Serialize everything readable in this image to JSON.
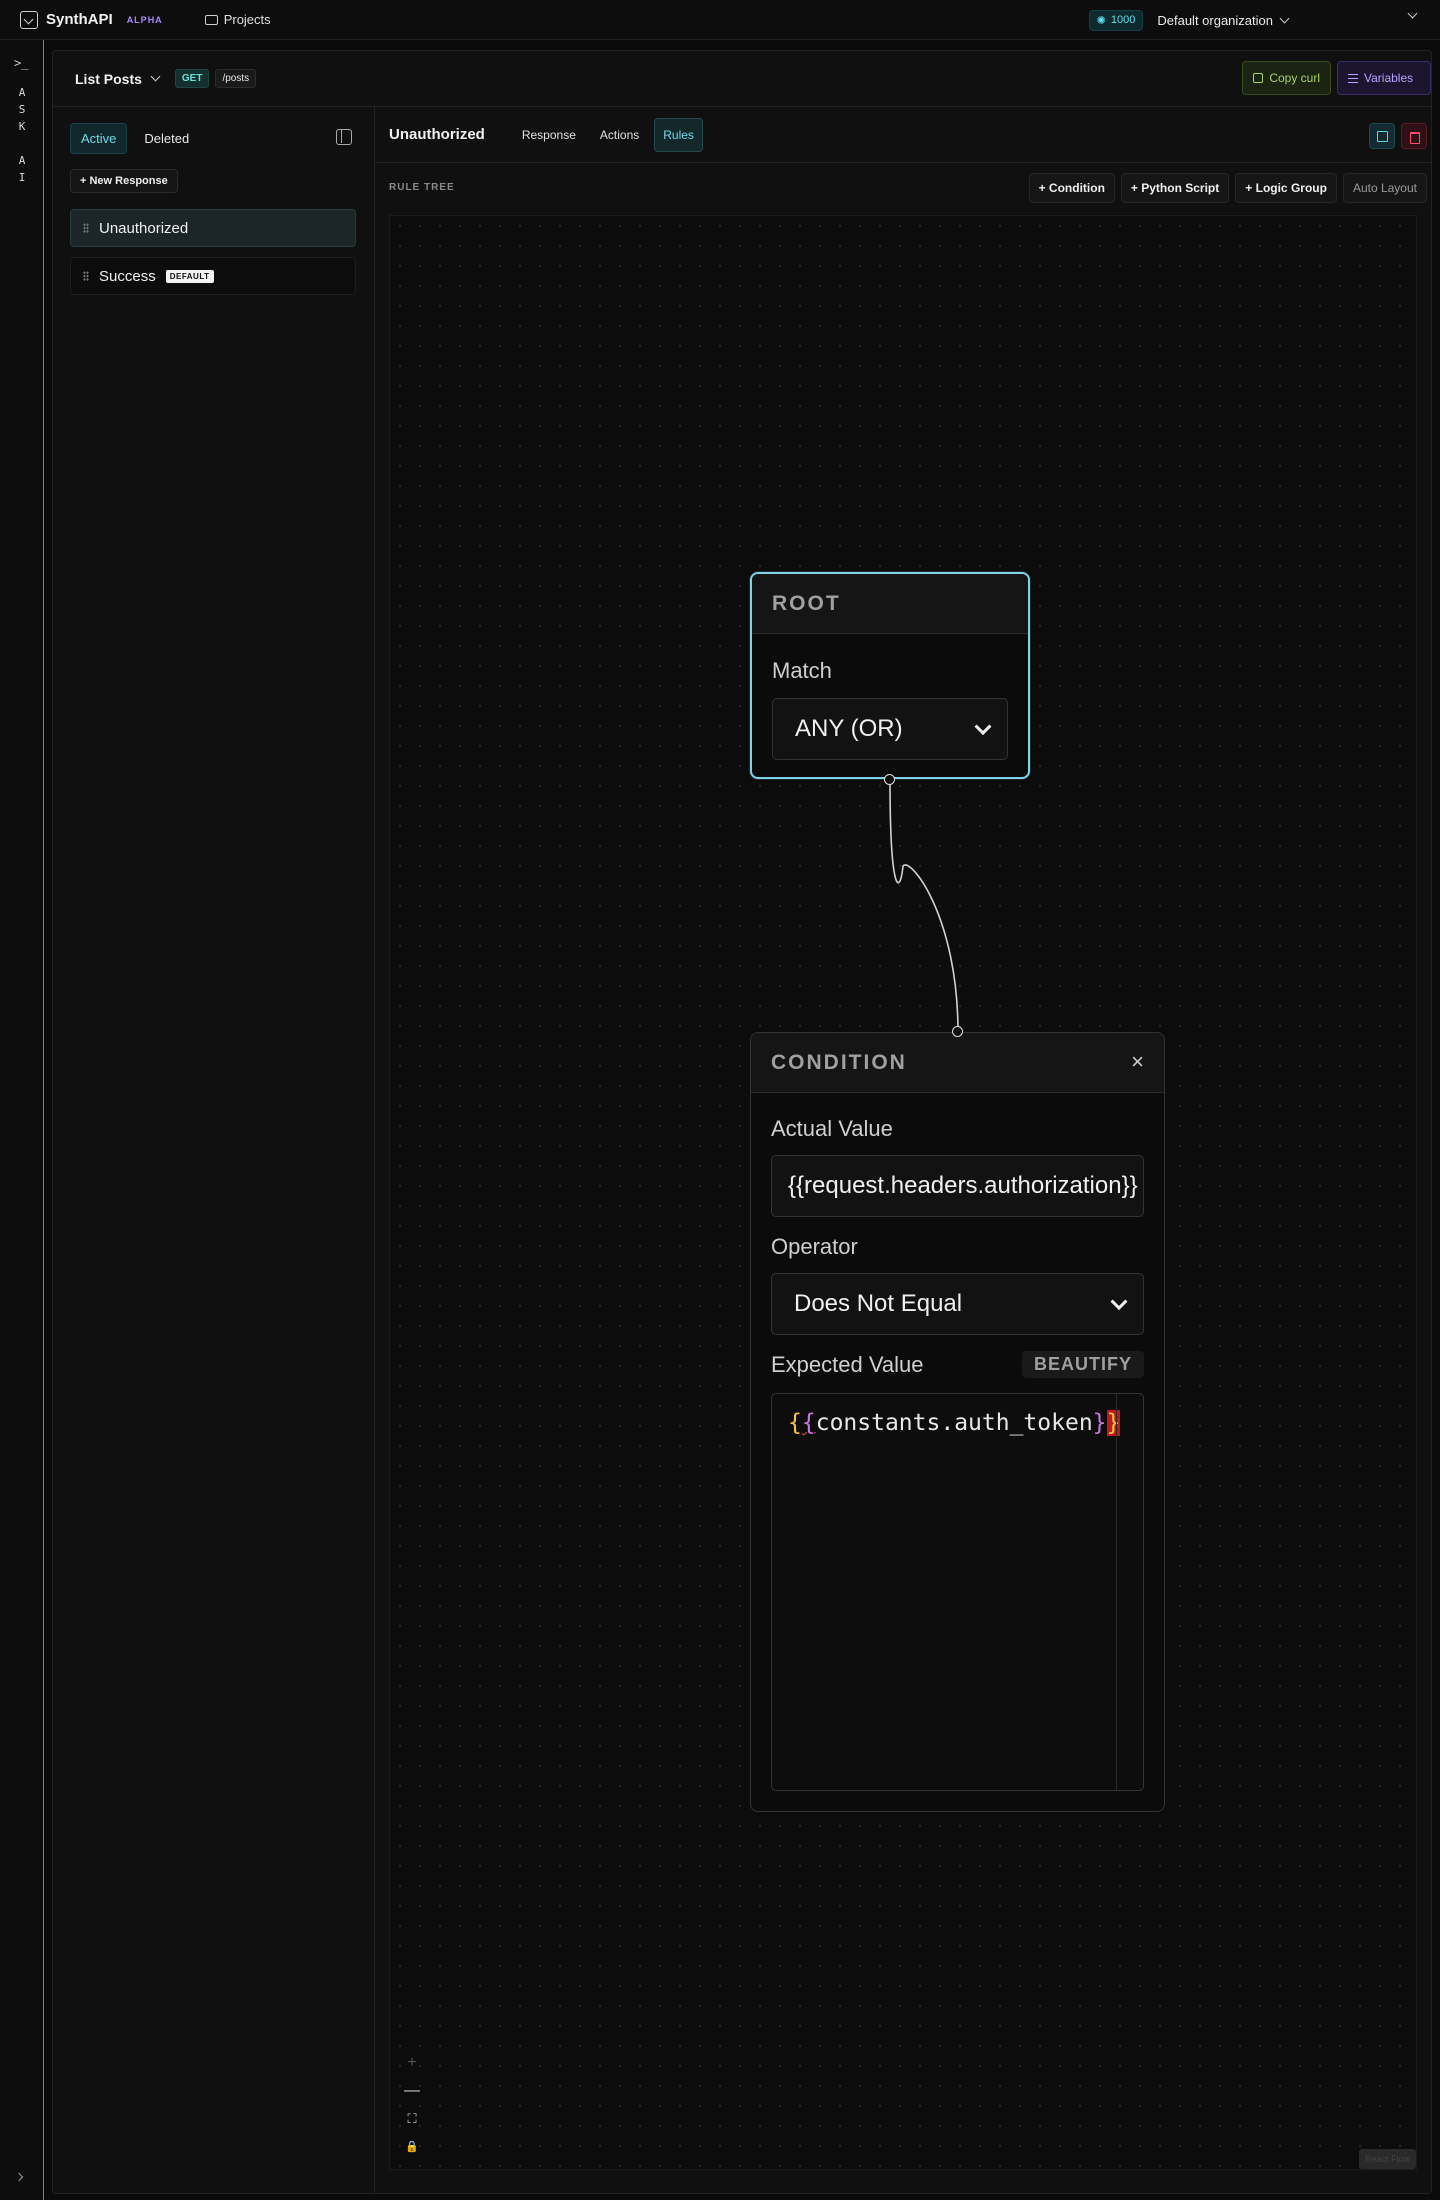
{
  "app": {
    "name": "SynthAPI",
    "badge": "ALPHA",
    "projects_label": "Projects"
  },
  "topbar": {
    "credits": "1000",
    "organization": "Default organization"
  },
  "rail": {
    "terminal": ">_",
    "ask_ai": "A\nS\nK\n\nA\nI"
  },
  "endpoint": {
    "name": "List Posts",
    "method": "GET",
    "path": "/posts",
    "copy_curl": "Copy curl",
    "variables": "Variables"
  },
  "sidebar": {
    "filters": [
      "Active",
      "Deleted"
    ],
    "new_response": "+ New Response",
    "responses": [
      {
        "name": "Unauthorized",
        "badge": ""
      },
      {
        "name": "Success",
        "badge": "DEFAULT"
      }
    ]
  },
  "main": {
    "title": "Unauthorized",
    "tabs": [
      "Response",
      "Actions",
      "Rules"
    ],
    "active_tab": "Rules",
    "tree_label": "RULE TREE",
    "tools": [
      "+ Condition",
      "+ Python Script",
      "+ Logic Group",
      "Auto Layout"
    ]
  },
  "root_node": {
    "header": "ROOT",
    "match_label": "Match",
    "match_value": "ANY (OR)"
  },
  "condition_node": {
    "header": "CONDITION",
    "close": "×",
    "actual_label": "Actual Value",
    "actual_value": "{{request.headers.authorization}}",
    "operator_label": "Operator",
    "operator_value": "Does Not Equal",
    "expected_label": "Expected Value",
    "beautify": "BEAUTIFY",
    "expected_value": {
      "open_outer": "{",
      "open_inner": "{",
      "text": "constants.auth_token",
      "close_inner": "}",
      "close_outer": "}"
    }
  },
  "canvas_controls": {
    "zoom_in": "+",
    "zoom_out": "—",
    "fit": "⛶",
    "lock": "🔒",
    "minimap": "React Flow"
  },
  "colors": {
    "accent": "#6fd9e8",
    "rail_border": "#7c6cf0",
    "copy_green": "#a8d36a",
    "variables_purple": "#b9a3ff",
    "delete_red": "#ff4d6d"
  }
}
